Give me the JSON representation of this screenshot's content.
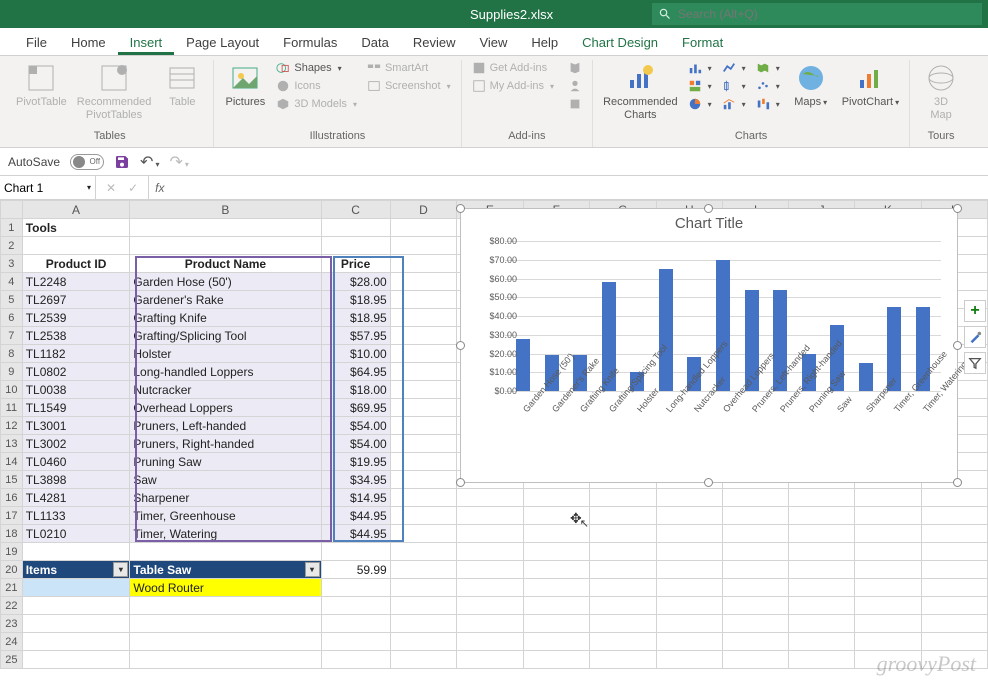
{
  "window": {
    "filename": "Supplies2.xlsx",
    "search_placeholder": "Search (Alt+Q)"
  },
  "tabs": [
    "File",
    "Home",
    "Insert",
    "Page Layout",
    "Formulas",
    "Data",
    "Review",
    "View",
    "Help",
    "Chart Design",
    "Format"
  ],
  "active_tab": "Insert",
  "ribbon": {
    "tables": {
      "pivot": "PivotTable",
      "rec": "Recommended\nPivotTables",
      "table": "Table",
      "label": "Tables"
    },
    "illus": {
      "pictures": "Pictures",
      "shapes": "Shapes",
      "icons": "Icons",
      "models": "3D Models",
      "smartart": "SmartArt",
      "screenshot": "Screenshot",
      "label": "Illustrations"
    },
    "addins": {
      "get": "Get Add-ins",
      "my": "My Add-ins",
      "label": "Add-ins"
    },
    "charts": {
      "rec": "Recommended\nCharts",
      "maps": "Maps",
      "pivotchart": "PivotChart",
      "label": "Charts"
    },
    "tours": {
      "map3d": "3D\nMap",
      "label": "Tours"
    }
  },
  "qat": {
    "autosave": "AutoSave",
    "autosave_state": "Off"
  },
  "namebox": "Chart 1",
  "fx_value": "",
  "columns": [
    "A",
    "B",
    "C",
    "D",
    "E",
    "F",
    "G",
    "H",
    "I",
    "J",
    "K",
    "L"
  ],
  "sheet_title": "Tools",
  "headers": {
    "a": "Product ID",
    "b": "Product Name",
    "c": "Price"
  },
  "rows": [
    {
      "n": 4,
      "id": "TL2248",
      "name": "Garden Hose (50')",
      "price": "$28.00"
    },
    {
      "n": 5,
      "id": "TL2697",
      "name": "Gardener's Rake",
      "price": "$18.95"
    },
    {
      "n": 6,
      "id": "TL2539",
      "name": "Grafting Knife",
      "price": "$18.95"
    },
    {
      "n": 7,
      "id": "TL2538",
      "name": "Grafting/Splicing Tool",
      "price": "$57.95"
    },
    {
      "n": 8,
      "id": "TL1182",
      "name": "Holster",
      "price": "$10.00"
    },
    {
      "n": 9,
      "id": "TL0802",
      "name": "Long-handled Loppers",
      "price": "$64.95"
    },
    {
      "n": 10,
      "id": "TL0038",
      "name": "Nutcracker",
      "price": "$18.00"
    },
    {
      "n": 11,
      "id": "TL1549",
      "name": "Overhead Loppers",
      "price": "$69.95"
    },
    {
      "n": 12,
      "id": "TL3001",
      "name": "Pruners, Left-handed",
      "price": "$54.00"
    },
    {
      "n": 13,
      "id": "TL3002",
      "name": "Pruners, Right-handed",
      "price": "$54.00"
    },
    {
      "n": 14,
      "id": "TL0460",
      "name": "Pruning Saw",
      "price": "$19.95"
    },
    {
      "n": 15,
      "id": "TL3898",
      "name": "Saw",
      "price": "$34.95"
    },
    {
      "n": 16,
      "id": "TL4281",
      "name": "Sharpener",
      "price": "$14.95"
    },
    {
      "n": 17,
      "id": "TL1133",
      "name": "Timer, Greenhouse",
      "price": "$44.95"
    },
    {
      "n": 18,
      "id": "TL0210",
      "name": "Timer, Watering",
      "price": "$44.95"
    }
  ],
  "items_row": {
    "a": "Items",
    "b": "Table Saw",
    "c": "59.99"
  },
  "row21": {
    "b": "Wood Router"
  },
  "chart_data": {
    "type": "bar",
    "title": "Chart Title",
    "ylabel": "",
    "xlabel": "",
    "ylim": [
      0,
      80
    ],
    "yticks": [
      "$0.00",
      "$10.00",
      "$20.00",
      "$30.00",
      "$40.00",
      "$50.00",
      "$60.00",
      "$70.00",
      "$80.00"
    ],
    "categories": [
      "Garden Hose (50')",
      "Gardener's Rake",
      "Grafting Knife",
      "Grafting/Splicing Tool",
      "Holster",
      "Long-handled Loppers",
      "Nutcracker",
      "Overhead Loppers",
      "Pruners, Left-handed",
      "Pruners, Right-handed",
      "Pruning Saw",
      "Saw",
      "Sharpener",
      "Timer, Greenhouse",
      "Timer, Watering"
    ],
    "values": [
      28.0,
      18.95,
      18.95,
      57.95,
      10.0,
      64.95,
      18.0,
      69.95,
      54.0,
      54.0,
      19.95,
      34.95,
      14.95,
      44.95,
      44.95
    ]
  },
  "watermark": "groovyPost"
}
